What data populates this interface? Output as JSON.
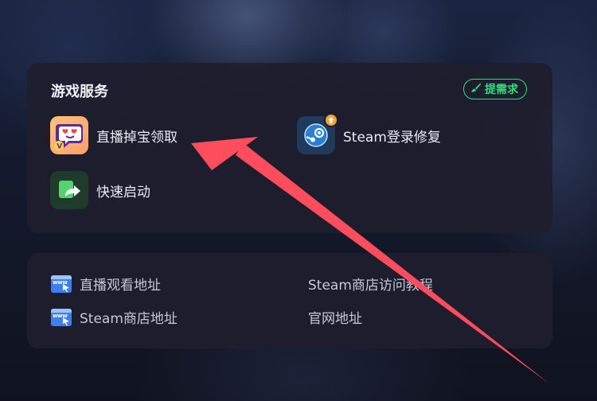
{
  "services": {
    "title": "游戏服务",
    "request_button": "提需求",
    "items": [
      {
        "label": "直播掉宝领取",
        "icon": "live-drop-icon"
      },
      {
        "label": "Steam登录修复",
        "icon": "steam-repair-icon"
      },
      {
        "label": "快速启动",
        "icon": "quick-launch-icon"
      }
    ]
  },
  "links": {
    "items": [
      {
        "label": "直播观看地址",
        "icon": "www-icon"
      },
      {
        "label": "Steam商店访问教程",
        "icon": null
      },
      {
        "label": "Steam商店地址",
        "icon": "www-icon"
      },
      {
        "label": "官网地址",
        "icon": null
      }
    ]
  },
  "colors": {
    "accent_green": "#2ee07a",
    "annotation_arrow": "#ff4d5e",
    "card_bg": "#1e1e2e"
  }
}
